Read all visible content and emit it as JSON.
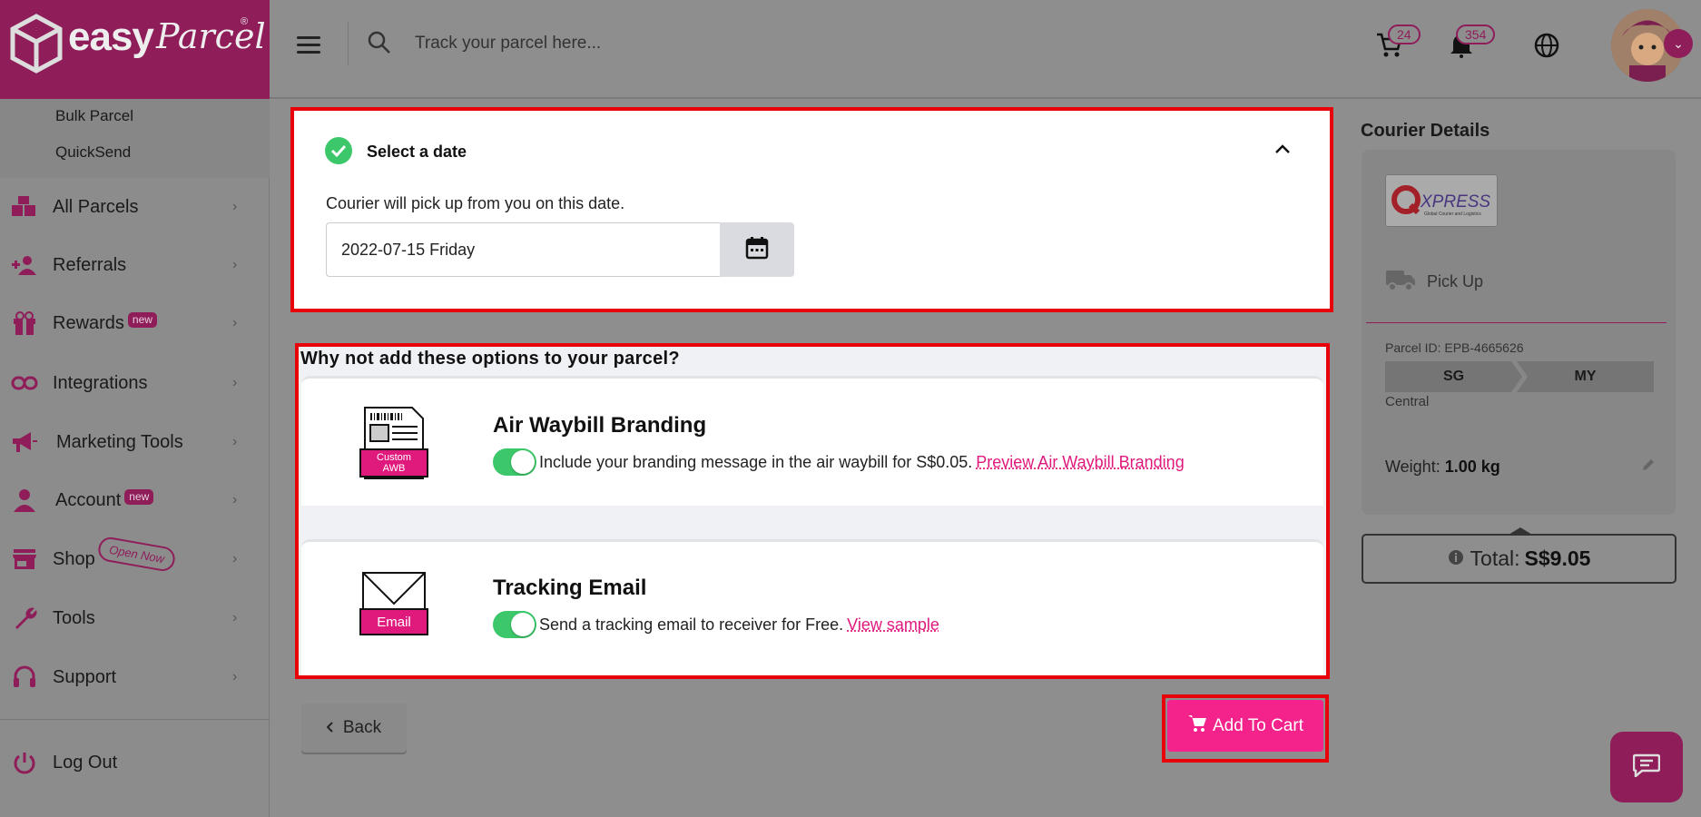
{
  "brand": {
    "logo_main": "easy",
    "logo_script": "Parcel",
    "logo_reg": "®"
  },
  "sidebar": {
    "sub_items": [
      {
        "label": "Bulk Parcel"
      },
      {
        "label": "QuickSend"
      }
    ],
    "items": [
      {
        "label": "All Parcels",
        "icon": "boxes-icon"
      },
      {
        "label": "Referrals",
        "icon": "add-user-icon"
      },
      {
        "label": "Rewards",
        "icon": "gift-icon",
        "badge": "new"
      },
      {
        "label": "Integrations",
        "icon": "link-icon"
      },
      {
        "label": "Marketing Tools",
        "icon": "megaphone-icon"
      },
      {
        "label": "Account",
        "icon": "person-icon",
        "badge": "new"
      },
      {
        "label": "Shop",
        "icon": "store-icon",
        "badge": "Open Now"
      },
      {
        "label": "Tools",
        "icon": "wrench-icon"
      },
      {
        "label": "Support",
        "icon": "headset-icon"
      }
    ],
    "logout": "Log Out",
    "chevron": "›"
  },
  "header": {
    "search_placeholder": "Track your parcel here...",
    "cart_count": "24",
    "notification_count": "354"
  },
  "date_section": {
    "title": "Select a date",
    "description": "Courier will pick up from you on this date.",
    "date_value": "2022-07-15 Friday"
  },
  "options": {
    "heading": "Why not add these options to your parcel?",
    "awb": {
      "image_label_line1": "Custom",
      "image_label_line2": "AWB",
      "title": "Air Waybill Branding",
      "description": "Include your branding message in the air waybill for S$0.05.",
      "link": "Preview Air Waybill Branding",
      "enabled": true
    },
    "email": {
      "image_label": "Email",
      "title": "Tracking Email",
      "description": "Send a tracking email to receiver for Free.",
      "link": "View sample",
      "enabled": true
    }
  },
  "actions": {
    "back": "Back",
    "add_to_cart": "Add To Cart"
  },
  "courier": {
    "section_title": "Courier Details",
    "logo_text": "XPRESS",
    "logo_tagline": "Global Courier and Logistics",
    "service": "Pick Up",
    "parcel_id": "Parcel ID: EPB-4665626",
    "from": "SG",
    "to": "MY",
    "region": "Central",
    "weight_label": "Weight:",
    "weight_value": "1.00 kg"
  },
  "total": {
    "label": "Total:",
    "value": "S$9.05"
  },
  "colors": {
    "brand": "#e0197d",
    "brand_dark": "#8e1d5a",
    "highlight": "#e8000b",
    "toggle_on": "#3cc86a"
  }
}
